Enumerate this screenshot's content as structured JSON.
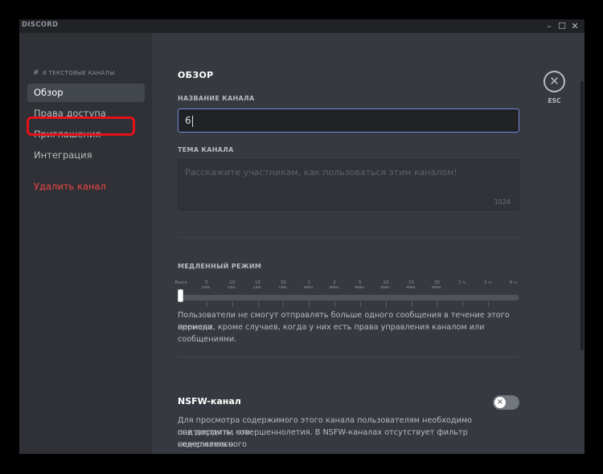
{
  "titlebar": {
    "logo": "DISCORD",
    "minimize": "–",
    "maximize": "☐",
    "close": "✕"
  },
  "sidebar": {
    "hash": "#",
    "channel": "6",
    "category": "ТЕКСТОВЫЕ КАНАЛЫ",
    "items": [
      {
        "label": "Обзор"
      },
      {
        "label": "Права доступа"
      },
      {
        "label": "Приглашения"
      },
      {
        "label": "Интеграция"
      },
      {
        "label": "Удалить канал"
      }
    ]
  },
  "main": {
    "section_title": "ОБЗОР",
    "name_label": "НАЗВАНИЕ КАНАЛА",
    "name_value": "6",
    "topic_label": "ТЕМА КАНАЛА",
    "topic_placeholder": "Расскажите участникам, как пользоваться этим каналом!",
    "topic_counter": "1024",
    "slowmode_label": "МЕДЛЕННЫЙ РЕЖИМ",
    "slowmode_ticks": [
      {
        "num": "Выкл",
        "unit": ""
      },
      {
        "num": "5",
        "unit": "сек."
      },
      {
        "num": "10",
        "unit": "сек."
      },
      {
        "num": "15",
        "unit": "сек."
      },
      {
        "num": "30",
        "unit": "сек."
      },
      {
        "num": "1",
        "unit": "мин."
      },
      {
        "num": "2",
        "unit": "мин."
      },
      {
        "num": "5",
        "unit": "мин."
      },
      {
        "num": "10",
        "unit": "мин."
      },
      {
        "num": "15",
        "unit": "мин."
      },
      {
        "num": "30",
        "unit": "мин."
      },
      {
        "num": "1 ч.",
        "unit": ""
      },
      {
        "num": "2 ч.",
        "unit": ""
      },
      {
        "num": "6 ч.",
        "unit": ""
      }
    ],
    "slowmode_selected": "Выкл",
    "slowmode_desc_1": "Пользователи не смогут отправлять больше одного сообщения в течение этого периода",
    "slowmode_desc_2": "времени, кроме случаев, когда у них есть права управления каналом или сообщениями.",
    "nsfw_title": "NSFW-канал",
    "nsfw_toggle_on": false,
    "nsfw_desc_1": "Для просмотра содержимого этого канала пользователям необходимо подтвердить, что",
    "nsfw_desc_2": "они достигли совершеннолетия. В NSFW-каналах отсутствует фильтр нежелательного",
    "nsfw_desc_3": "содержимого."
  },
  "close_button": {
    "icon": "close-icon",
    "label": "ESC"
  },
  "colors": {
    "accent": "#7289da",
    "danger": "#f04747",
    "highlight": "#e3121a",
    "background": "#36393f",
    "sidebar": "#2f3136"
  }
}
